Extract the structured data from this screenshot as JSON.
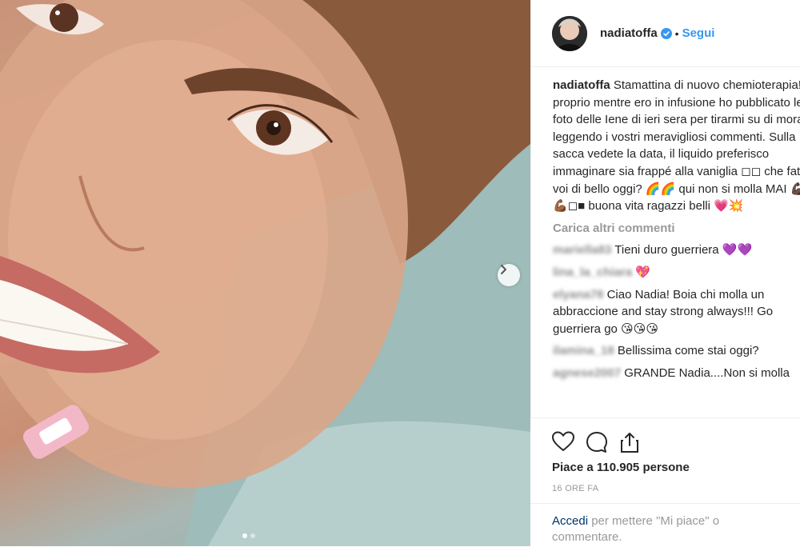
{
  "post": {
    "username": "nadiatoffa",
    "follow_label": "Segui",
    "separator": "•",
    "caption_user": "nadiatoffa",
    "caption_text": " Stamattina di nuovo chemioterapia! E proprio mentre ero in infusione ho pubblicato le foto delle Iene di ieri sera per tirarmi su di morale leggendo i vostri meravigliosi commenti. Sulla sacca vedete la data, il liquido preferisco immaginare sia frappé alla vaniglia ◻◻ che fate voi di bello oggi? 🌈🌈 qui non si molla MAI 💪🏿💪🏾◻■ buona vita ragazzi belli 💗💥",
    "load_more_label": "Carica altri commenti",
    "comments": [
      {
        "user": "mariella83",
        "text": "Tieni duro guerriera 💜💜"
      },
      {
        "user": "lina_la_chiara",
        "text": "💖"
      },
      {
        "user": "elyana78",
        "text": "Ciao Nadia! Boia chi molla un abbraccione and stay strong always!!! Go guerriera go 😘😘😘"
      },
      {
        "user": "ilamina_18",
        "text": "Bellissima come stai oggi?"
      },
      {
        "user": "agnese2007",
        "text": "GRANDE Nadia....Non si molla"
      }
    ],
    "likes_text": "Piace a 110.905 persone",
    "time_text": "16 ORE FA",
    "login_link": "Accedi",
    "login_text": " per mettere \"Mi piace\" o commentare.",
    "carousel": {
      "total": 2,
      "current": 1
    }
  },
  "icons": {
    "like": "heart-icon",
    "comment": "comment-bubble-icon",
    "share": "share-icon",
    "verified": "verified-badge-icon",
    "next": "chevron-right-icon"
  },
  "colors": {
    "link_blue": "#3897f0",
    "verified_blue": "#3897f0",
    "muted_gray": "#999999",
    "text": "#262626"
  }
}
